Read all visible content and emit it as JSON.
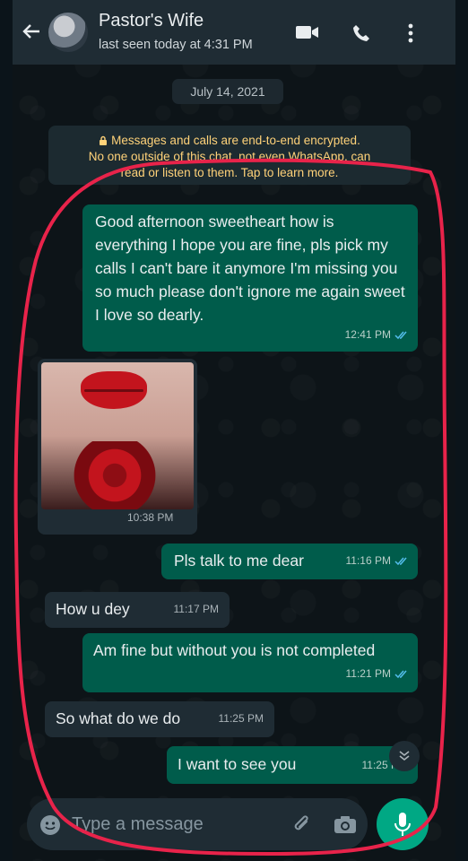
{
  "header": {
    "contact_name": "Pastor's Wife",
    "last_seen": "last seen today at 4:31 PM",
    "icons": [
      "back-arrow-icon",
      "avatar",
      "video-call-icon",
      "voice-call-icon",
      "more-options-icon"
    ]
  },
  "date_chip": "July 14, 2021",
  "encryption_notice": {
    "line1": "Messages and calls are end-to-end encrypted.",
    "line2": "No one outside of this chat, not even WhatsApp, can",
    "line3": "read or listen to them. Tap to learn more."
  },
  "messages": [
    {
      "direction": "outgoing",
      "text": "Good afternoon sweetheart how is everything I hope you are fine, pls pick my calls I can't bare it anymore I'm missing you so much please don't ignore me again sweet I love so dearly.",
      "time": "12:41 PM",
      "status": "read"
    },
    {
      "direction": "incoming",
      "type": "image",
      "text": "",
      "time": "10:38 PM"
    },
    {
      "direction": "outgoing",
      "text": "Pls talk to me dear",
      "time": "11:16 PM",
      "status": "read"
    },
    {
      "direction": "incoming",
      "text": "How u dey",
      "time": "11:17 PM"
    },
    {
      "direction": "outgoing",
      "text": "Am fine but without you is not completed",
      "time": "11:21 PM",
      "status": "read"
    },
    {
      "direction": "incoming",
      "text": "So what do we do",
      "time": "11:25 PM"
    },
    {
      "direction": "outgoing",
      "text": "I want to see you",
      "time": "11:25 PM",
      "status": "sent"
    }
  ],
  "composer": {
    "placeholder": "Type a message"
  },
  "colors": {
    "header_bg": "#1f2c34",
    "outgoing_bubble": "#005c4b",
    "incoming_bubble": "#1f2c34",
    "accent": "#00a884",
    "read_ticks": "#53bdeb",
    "annotation_outline": "#e8234a"
  }
}
